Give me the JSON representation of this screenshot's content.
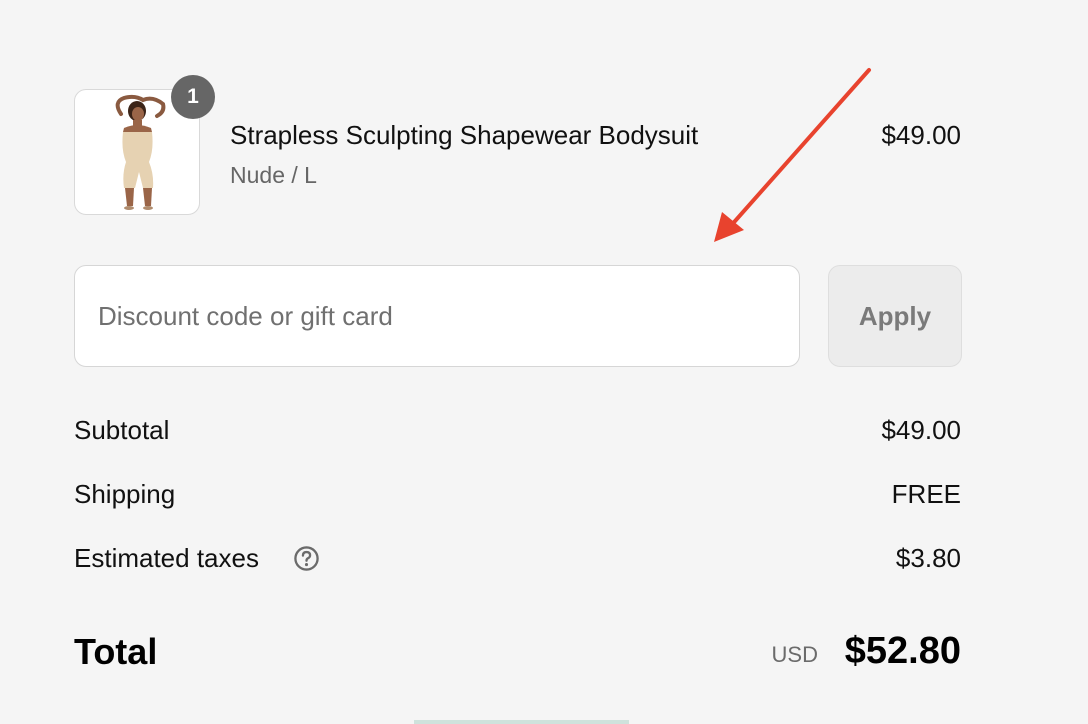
{
  "line_item": {
    "quantity": "1",
    "title": "Strapless Sculpting Shapewear Bodysuit",
    "variant": "Nude / L",
    "price": "$49.00",
    "image_icon": "product-photo-shapewear-bodysuit"
  },
  "discount": {
    "placeholder": "Discount code or gift card",
    "value": "",
    "apply_label": "Apply"
  },
  "summary": {
    "subtotal_label": "Subtotal",
    "subtotal_value": "$49.00",
    "shipping_label": "Shipping",
    "shipping_value": "FREE",
    "taxes_label": "Estimated taxes",
    "taxes_value": "$3.80",
    "taxes_help_icon": "question-circle-icon",
    "total_label": "Total",
    "currency": "USD",
    "total_value": "$52.80"
  },
  "annotation": {
    "icon": "red-arrow-icon",
    "color": "#e8432e"
  },
  "colors": {
    "background": "#f5f5f5",
    "badge": "#666666",
    "muted_text": "#666666",
    "apply_bg": "#ececec"
  }
}
